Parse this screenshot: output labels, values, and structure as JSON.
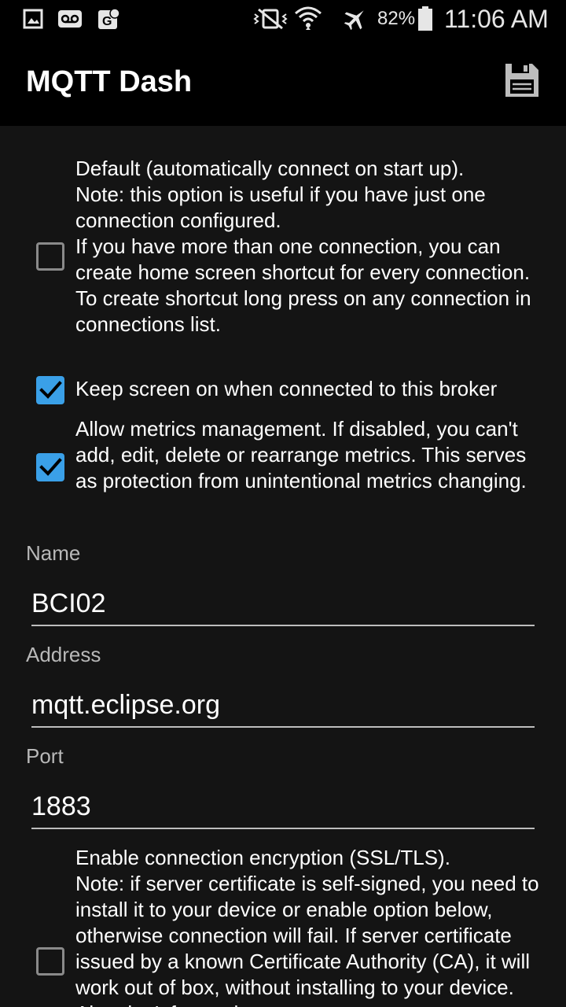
{
  "status_bar": {
    "icons": [
      "gallery-icon",
      "voicemail-icon",
      "maps-icon",
      "vibrate-off-icon",
      "wifi-icon",
      "airplane-mode-icon",
      "battery-icon"
    ],
    "battery": "82%",
    "time": "11:06 AM"
  },
  "app_bar": {
    "title": "MQTT Dash",
    "save_icon": "floppy-disk-icon"
  },
  "options": {
    "default": {
      "checked": false,
      "text": "Default (automatically connect on start up).\nNote: this option is useful if you have just one connection configured.\nIf you have more than one connection, you can create home screen shortcut for every connection.\nTo create shortcut long press on any connection in connections list."
    },
    "keep_screen": {
      "checked": true,
      "text": "Keep screen on when connected to this broker"
    },
    "metrics": {
      "checked": true,
      "text": "Allow metrics management. If disabled, you can't add, edit, delete or rearrange metrics. This serves as protection from unintentional metrics changing."
    },
    "encryption": {
      "checked": false,
      "text": "Enable connection encryption (SSL/TLS).\nNote: if server certificate is self-signed, you need to install it to your device or enable option below, otherwise connection will fail. If server certificate issued by a known Certificate Authority (CA), it will work out of box, without installing to your device. Also don't forget that"
    }
  },
  "fields": {
    "name": {
      "label": "Name",
      "value": "BCI02"
    },
    "address": {
      "label": "Address",
      "value": "mqtt.eclipse.org"
    },
    "port": {
      "label": "Port",
      "value": "1883"
    }
  },
  "colors": {
    "accent": "#3aa0e8",
    "background": "#141414",
    "bar": "#000000"
  }
}
